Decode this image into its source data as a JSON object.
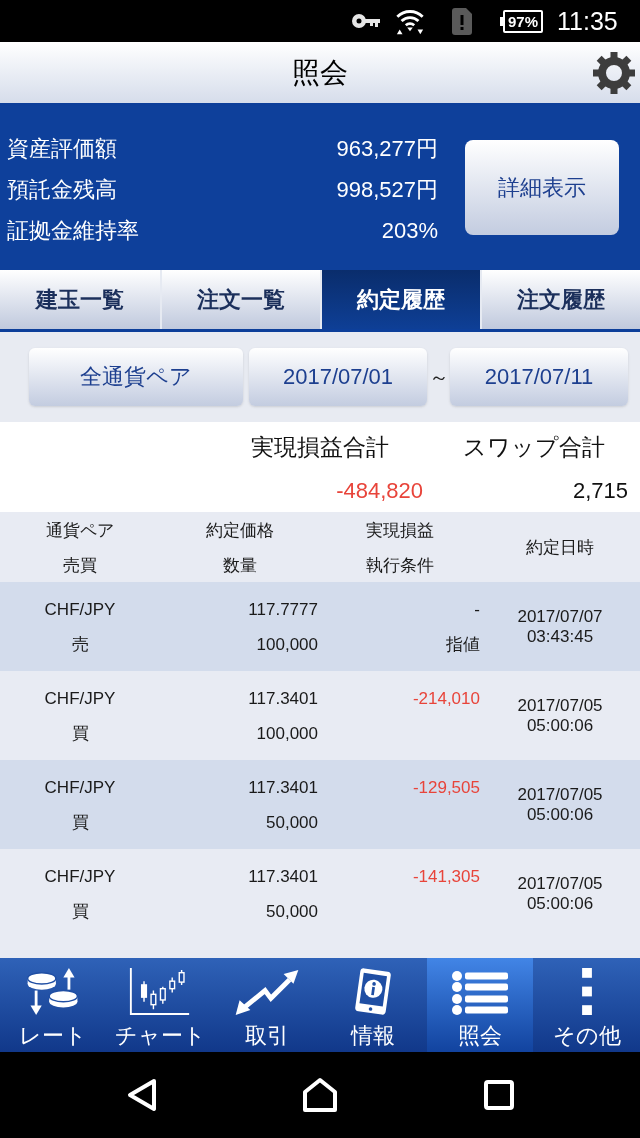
{
  "status_bar": {
    "battery": "97%",
    "time": "11:35"
  },
  "title_bar": {
    "title": "照会"
  },
  "summary": {
    "rows": [
      {
        "label": "資産評価額",
        "value": "963,277円"
      },
      {
        "label": "預託金残高",
        "value": "998,527円"
      },
      {
        "label": "証拠金維持率",
        "value": "203%"
      }
    ],
    "detail_button": "詳細表示"
  },
  "tabs": [
    {
      "label": "建玉一覧",
      "selected": false
    },
    {
      "label": "注文一覧",
      "selected": false
    },
    {
      "label": "約定履歴",
      "selected": true
    },
    {
      "label": "注文履歴",
      "selected": false
    }
  ],
  "filters": {
    "currency_pair": "全通貨ペア",
    "date_from": "2017/07/01",
    "separator": "～",
    "date_to": "2017/07/11"
  },
  "totals": [
    {
      "label": "実現損益合計",
      "value": "-484,820",
      "negative": true
    },
    {
      "label": "スワップ合計",
      "value": "2,715",
      "negative": false
    }
  ],
  "table": {
    "columns": [
      {
        "lines": [
          "通貨ペア",
          "売買"
        ]
      },
      {
        "lines": [
          "約定価格",
          "数量"
        ]
      },
      {
        "lines": [
          "実現損益",
          "執行条件"
        ]
      },
      {
        "lines": [
          "約定日時"
        ]
      }
    ],
    "rows": [
      {
        "pair": "CHF/JPY",
        "side": "売",
        "price": "117.7777",
        "quantity": "100,000",
        "pnl": "-",
        "pnl_negative": false,
        "condition": "指値",
        "date": "2017/07/07",
        "time": "03:43:45"
      },
      {
        "pair": "CHF/JPY",
        "side": "買",
        "price": "117.3401",
        "quantity": "100,000",
        "pnl": "-214,010",
        "pnl_negative": true,
        "date": "2017/07/05",
        "time": "05:00:06"
      },
      {
        "pair": "CHF/JPY",
        "side": "買",
        "price": "117.3401",
        "quantity": "50,000",
        "pnl": "-129,505",
        "pnl_negative": true,
        "date": "2017/07/05",
        "time": "05:00:06"
      },
      {
        "pair": "CHF/JPY",
        "side": "買",
        "price": "117.3401",
        "quantity": "50,000",
        "pnl": "-141,305",
        "pnl_negative": true,
        "date": "2017/07/05",
        "time": "05:00:06"
      }
    ]
  },
  "bottom_nav": [
    {
      "label": "レート",
      "selected": false
    },
    {
      "label": "チャート",
      "selected": false
    },
    {
      "label": "取引",
      "selected": false
    },
    {
      "label": "情報",
      "selected": false
    },
    {
      "label": "照会",
      "selected": true
    },
    {
      "label": "その他",
      "selected": false
    }
  ]
}
